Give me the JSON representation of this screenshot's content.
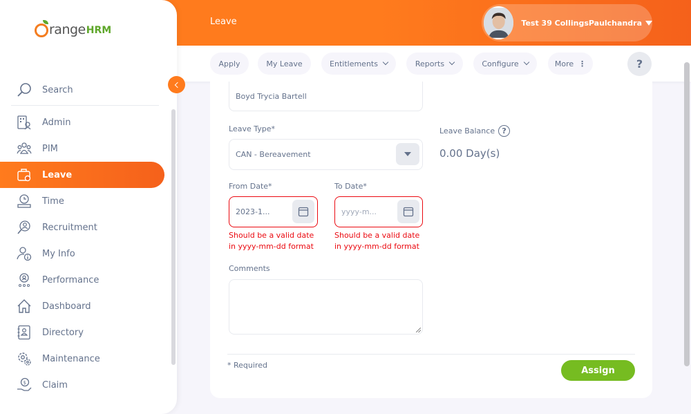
{
  "header": {
    "module_title": "Leave",
    "user_name": "Test 39 CollingsPaulchandra"
  },
  "subnav": {
    "items": [
      {
        "label": "Apply"
      },
      {
        "label": "My Leave"
      },
      {
        "label": "Entitlements"
      },
      {
        "label": "Reports"
      },
      {
        "label": "Configure"
      },
      {
        "label": "More"
      }
    ],
    "help": "?"
  },
  "sidebar": {
    "logo_main": "range",
    "logo_hrm": "HRM",
    "search_label": "Search",
    "items": [
      {
        "label": "Admin",
        "icon": "admin-icon"
      },
      {
        "label": "PIM",
        "icon": "pim-icon"
      },
      {
        "label": "Leave",
        "icon": "leave-icon"
      },
      {
        "label": "Time",
        "icon": "time-icon"
      },
      {
        "label": "Recruitment",
        "icon": "recruitment-icon"
      },
      {
        "label": "My Info",
        "icon": "my-info-icon"
      },
      {
        "label": "Performance",
        "icon": "performance-icon"
      },
      {
        "label": "Dashboard",
        "icon": "dashboard-icon"
      },
      {
        "label": "Directory",
        "icon": "directory-icon"
      },
      {
        "label": "Maintenance",
        "icon": "maintenance-icon"
      },
      {
        "label": "Claim",
        "icon": "claim-icon"
      }
    ],
    "active_item": "Leave"
  },
  "form": {
    "employee_value": "Boyd Trycia Bartell",
    "leave_type_label": "Leave Type*",
    "leave_type_value": "CAN - Bereavement",
    "leave_balance_label": "Leave Balance",
    "leave_balance_value": "0.00 Day(s)",
    "from_date_label": "From Date*",
    "from_date_value": "2023-1...",
    "from_date_error": "Should be a valid date in yyyy-mm-dd format",
    "to_date_label": "To Date*",
    "to_date_placeholder": "yyyy-m...",
    "to_date_error": "Should be a valid date in yyyy-mm-dd format",
    "comments_label": "Comments",
    "required_note": "* Required",
    "assign_label": "Assign"
  },
  "colors": {
    "brand_orange": "#ff7b1d",
    "error_red": "#eb0910",
    "assign_green": "#76bc21"
  }
}
